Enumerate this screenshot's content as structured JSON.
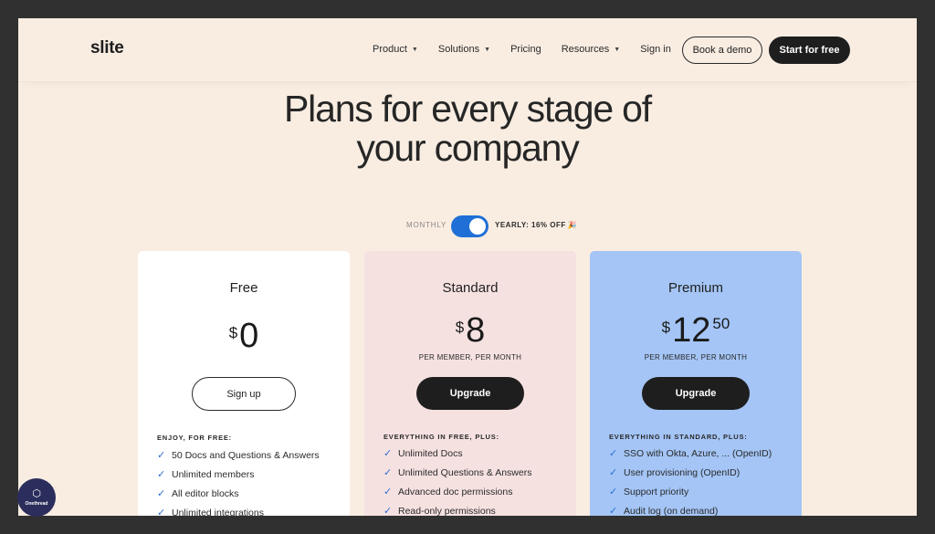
{
  "nav": {
    "logo": "slite",
    "links": [
      {
        "label": "Product",
        "has_caret": true
      },
      {
        "label": "Solutions",
        "has_caret": true
      },
      {
        "label": "Pricing",
        "has_caret": false
      },
      {
        "label": "Resources",
        "has_caret": true
      },
      {
        "label": "Sign in",
        "has_caret": false
      }
    ],
    "demo_button": "Book a demo",
    "start_button": "Start for free"
  },
  "hero": {
    "title_line1": "Plans for every stage of",
    "title_line2": "your company"
  },
  "billing": {
    "monthly_label": "MONTHLY",
    "yearly_label": "YEARLY: 16% OFF",
    "yearly_emoji": "🎉",
    "selected": "yearly"
  },
  "plans": [
    {
      "name": "Free",
      "currency": "$",
      "amount": "0",
      "cents": "",
      "per": "",
      "cta": "Sign up",
      "features_heading": "ENJOY, FOR FREE:",
      "features": [
        "50 Docs and Questions & Answers",
        "Unlimited members",
        "All editor blocks",
        "Unlimited integrations"
      ]
    },
    {
      "name": "Standard",
      "currency": "$",
      "amount": "8",
      "cents": "",
      "per": "PER MEMBER, PER MONTH",
      "cta": "Upgrade",
      "features_heading": "EVERYTHING IN FREE, PLUS:",
      "features": [
        "Unlimited Docs",
        "Unlimited Questions & Answers",
        "Advanced doc permissions",
        "Read-only permissions"
      ]
    },
    {
      "name": "Premium",
      "currency": "$",
      "amount": "12",
      "cents": "50",
      "per": "PER MEMBER, PER MONTH",
      "cta": "Upgrade",
      "features_heading": "EVERYTHING IN STANDARD, PLUS:",
      "features": [
        "SSO with Okta, Azure, ... (OpenID)",
        "User provisioning (OpenID)",
        "Support priority",
        "Audit log (on demand)"
      ]
    }
  ],
  "colors": {
    "page_bg": "#f9ede2",
    "standard_card": "#f6e1e1",
    "premium_card": "#a4c5f6",
    "toggle_accent": "#1f6fd6",
    "check": "#2d6fd1"
  },
  "badge": {
    "text": "Onethread",
    "icon": "box-icon"
  }
}
